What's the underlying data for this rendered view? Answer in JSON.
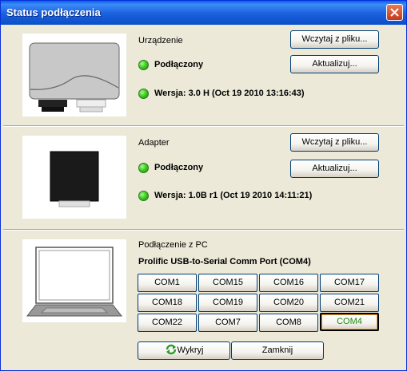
{
  "window": {
    "title": "Status podłączenia"
  },
  "device": {
    "heading": "Urządzenie",
    "status": "Podłączony",
    "version": "Wersja: 3.0 H (Oct 19 2010 13:16:43)",
    "load_button": "Wczytaj z pliku...",
    "update_button": "Aktualizuj..."
  },
  "adapter": {
    "heading": "Adapter",
    "status": "Podłączony",
    "version": "Wersja: 1.0B r1 (Oct 19 2010 14:11:21)",
    "load_button": "Wczytaj z pliku...",
    "update_button": "Aktualizuj..."
  },
  "pc": {
    "heading": "Podłączenie z PC",
    "port_name": "Prolific USB-to-Serial Comm Port (COM4)",
    "ports": [
      "COM1",
      "COM15",
      "COM16",
      "COM17",
      "COM18",
      "COM19",
      "COM20",
      "COM21",
      "COM22",
      "COM7",
      "COM8",
      "COM4"
    ],
    "selected_port": "COM4"
  },
  "footer": {
    "detect_button": "Wykryj",
    "close_button": "Zamknij"
  },
  "colors": {
    "status_led": "#3fcf1f",
    "selected_port_text": "#1a8a0c"
  }
}
